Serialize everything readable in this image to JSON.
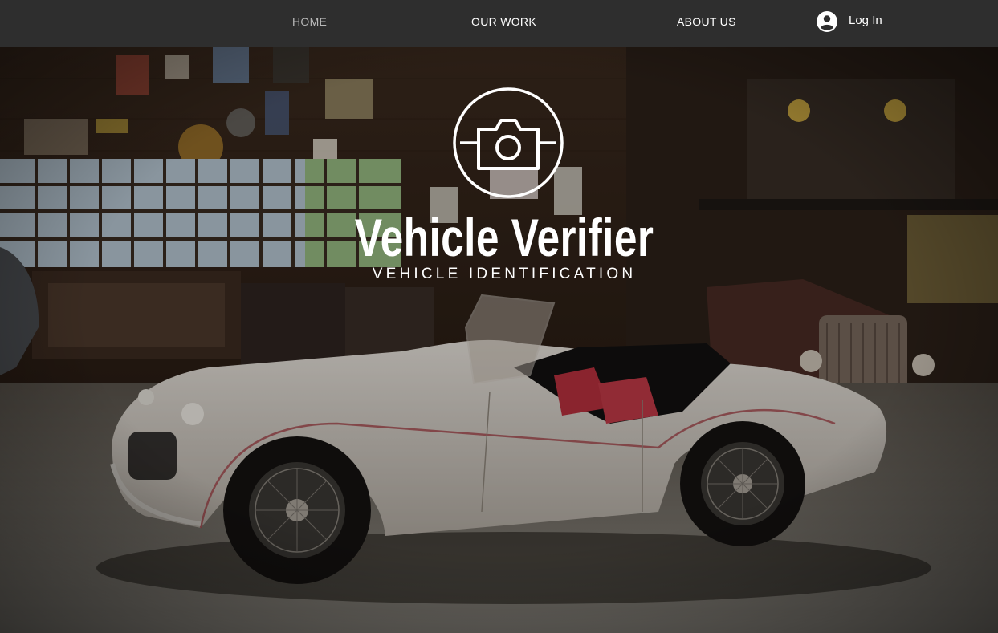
{
  "nav": {
    "items": [
      {
        "label": "HOME",
        "active": true
      },
      {
        "label": "OUR WORK",
        "active": false
      },
      {
        "label": "ABOUT US",
        "active": false
      }
    ],
    "login_label": "Log In",
    "login_icon": "user-avatar-icon"
  },
  "hero": {
    "logo_icon": "camera-icon",
    "title": "Vehicle Verifier",
    "tagline": "VEHICLE IDENTIFICATION",
    "background": "classic white convertible sports car in a vintage garage"
  },
  "colors": {
    "header_bg": "#2e2e2e",
    "nav_active": "#b9b9b9",
    "nav_text": "#ffffff",
    "hero_text": "#ffffff"
  }
}
